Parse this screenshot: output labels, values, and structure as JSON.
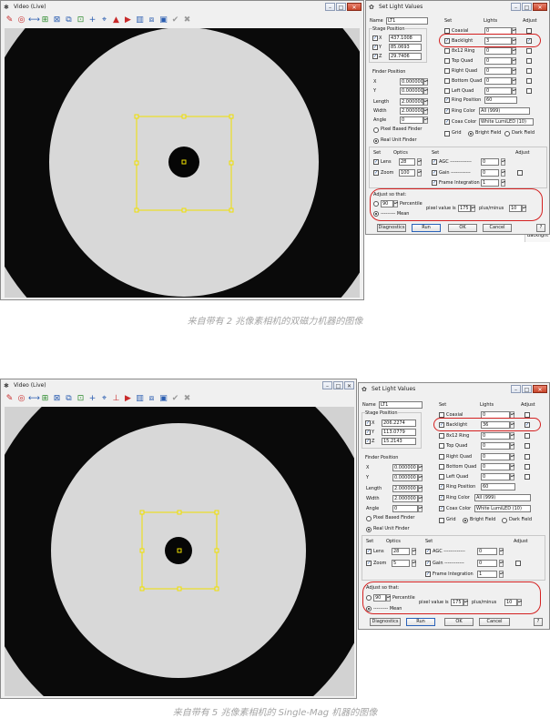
{
  "top": {
    "video_window": {
      "title": "Video (Live)"
    },
    "dialog": {
      "title": "Set Light Values",
      "name_label": "Name",
      "name_value": "LT1",
      "stage_position_label": "Stage Position",
      "x_label": "X",
      "x_value": "437.1008",
      "y_label": "Y",
      "y_value": "85.0693",
      "z_label": "Z",
      "z_value": "29.7406",
      "finder_position_label": "Finder Position",
      "fx_label": "X",
      "fx_value": "0.000000",
      "fy_label": "Y",
      "fy_value": "0.000000",
      "length_label": "Length",
      "length_value": "2.000000",
      "width_label": "Width",
      "width_value": "2.000000",
      "angle_label": "Angle",
      "angle_value": "0",
      "pixel_based_label": "Pixel Based Finder",
      "real_unit_label": "Real Unit Finder",
      "set_label": "Set",
      "lights_label": "Lights",
      "adjust_label": "Adjust",
      "lights": [
        {
          "label": "Coaxial",
          "value": "0",
          "checked": false
        },
        {
          "label": "Backlight",
          "value": "3",
          "checked": true
        },
        {
          "label": "8x12 Ring",
          "value": "0",
          "checked": false
        },
        {
          "label": "Top Quad",
          "value": "0",
          "checked": false
        },
        {
          "label": "Right Quad",
          "value": "0",
          "checked": false
        },
        {
          "label": "Bottom Quad",
          "value": "0",
          "checked": false
        },
        {
          "label": "Left Quad",
          "value": "0",
          "checked": false
        }
      ],
      "ring_position_label": "Ring Position",
      "ring_position_value": "60",
      "ring_color_label": "Ring Color",
      "ring_color_value": "All (999)",
      "coax_color_label": "Coax Color",
      "coax_color_value": "White LumiLED (10)",
      "grid_label": "Grid",
      "bright_field_label": "Bright Field",
      "dark_field_label": "Dark Field",
      "optics_set_label": "Set",
      "optics_label": "Optics",
      "set2_label": "Set",
      "adjust2_label": "Adjust",
      "lens_label": "Lens",
      "lens_value": "28",
      "zoom_label": "Zoom",
      "zoom_value": "100",
      "agc_label": "AGC -------------",
      "agc_value": "0",
      "gain_label": "Gain ------------",
      "gain_value": "0",
      "frame_integration_label": "Frame Integration",
      "frame_integration_value": "1",
      "adjust_so_that_label": "Adjust so that:",
      "percentile_value": "90",
      "percentile_label": "Percentile",
      "mean_label": "--------- Mean",
      "pixel_value_label": "pixel value is",
      "pixel_value": "175",
      "plus_minus_label": "plus/minus",
      "plus_minus_value": "10",
      "diagnostics_label": "Diagnostics",
      "run_label": "Run",
      "ok_label": "OK",
      "cancel_label": "Cancel",
      "help_label": "?"
    },
    "backdrop_text": "Backlight",
    "caption": "来自带有 2 兆像素相机的双磁力机器的图像"
  },
  "bottom": {
    "video_window": {
      "title": "Video (Live)"
    },
    "dialog": {
      "title": "Set Light Values",
      "name_label": "Name",
      "name_value": "LT1",
      "stage_position_label": "Stage Position",
      "x_label": "X",
      "x_value": "206.2274",
      "y_label": "Y",
      "y_value": "113.0779",
      "z_label": "Z",
      "z_value": "15.2143",
      "finder_position_label": "Finder Position",
      "fx_label": "X",
      "fx_value": "0.000000",
      "fy_label": "Y",
      "fy_value": "0.000000",
      "length_label": "Length",
      "length_value": "2.000000",
      "width_label": "Width",
      "width_value": "2.000000",
      "angle_label": "Angle",
      "angle_value": "0",
      "pixel_based_label": "Pixel Based Finder",
      "real_unit_label": "Real Unit Finder",
      "set_label": "Set",
      "lights_label": "Lights",
      "adjust_label": "Adjust",
      "lights": [
        {
          "label": "Coaxial",
          "value": "0",
          "checked": false
        },
        {
          "label": "Backlight",
          "value": "36",
          "checked": true
        },
        {
          "label": "8x12 Ring",
          "value": "0",
          "checked": false
        },
        {
          "label": "Top Quad",
          "value": "0",
          "checked": false
        },
        {
          "label": "Right Quad",
          "value": "0",
          "checked": false
        },
        {
          "label": "Bottom Quad",
          "value": "0",
          "checked": false
        },
        {
          "label": "Left Quad",
          "value": "0",
          "checked": false
        }
      ],
      "ring_position_label": "Ring Position",
      "ring_position_value": "60",
      "ring_color_label": "Ring Color",
      "ring_color_value": "All (999)",
      "coax_color_label": "Coax Color",
      "coax_color_value": "White LumiLED (10)",
      "grid_label": "Grid",
      "bright_field_label": "Bright Field",
      "dark_field_label": "Dark Field",
      "optics_set_label": "Set",
      "optics_label": "Optics",
      "set2_label": "Set",
      "adjust2_label": "Adjust",
      "lens_label": "Lens",
      "lens_value": "28",
      "zoom_label": "Zoom",
      "zoom_value": "5",
      "agc_label": "AGC -------------",
      "agc_value": "0",
      "gain_label": "Gain ------------",
      "gain_value": "0",
      "frame_integration_label": "Frame Integration",
      "frame_integration_value": "1",
      "adjust_so_that_label": "Adjust so that:",
      "percentile_value": "90",
      "percentile_label": "Percentile",
      "mean_label": "--------- Mean",
      "pixel_value_label": "pixel value is",
      "pixel_value": "175",
      "plus_minus_label": "plus/minus",
      "plus_minus_value": "10",
      "diagnostics_label": "Diagnostics",
      "run_label": "Run",
      "ok_label": "OK",
      "cancel_label": "Cancel",
      "help_label": "?"
    },
    "caption": "来自带有 5 兆像素相机的 Single-Mag 机器的图像"
  },
  "colors": {
    "highlight": "#d42020",
    "finder": "#f0e000",
    "accent": "#1f4fa0"
  }
}
